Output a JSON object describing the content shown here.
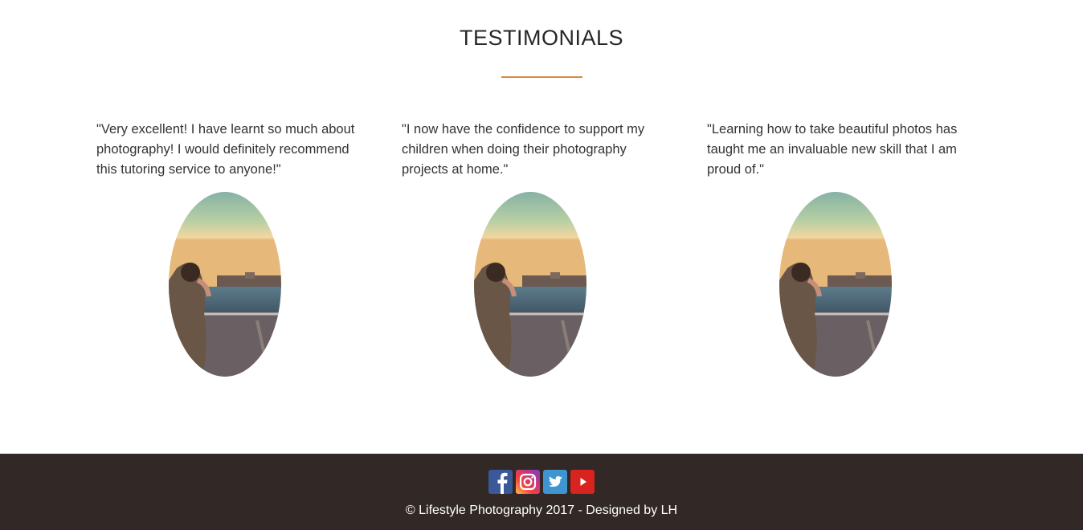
{
  "section": {
    "title": "TESTIMONIALS"
  },
  "testimonials": [
    {
      "quote": "\"Very excellent! I have learnt so much about photography! I would definitely recommend this tutoring service to anyone!\""
    },
    {
      "quote": "\"I now have the confidence to support my children when doing their photography projects at home.\""
    },
    {
      "quote": "\"Learning how to take beautiful photos has taught me an invaluable new skill that I am proud of.\""
    }
  ],
  "footer": {
    "social": [
      {
        "name": "facebook-icon",
        "color": "#3b5998"
      },
      {
        "name": "instagram-icon",
        "color": "#c13584"
      },
      {
        "name": "twitter-icon",
        "color": "#3f95d0"
      },
      {
        "name": "youtube-icon",
        "color": "#d8231f"
      }
    ],
    "copyright": "© Lifestyle Photography 2017 - Designed by LH"
  },
  "colors": {
    "accent": "#d98a3b",
    "footer_bg": "#322926"
  }
}
